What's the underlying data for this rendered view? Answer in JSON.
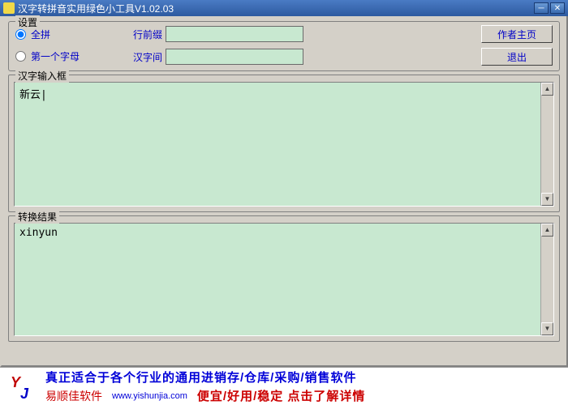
{
  "titlebar": {
    "title": "汉字转拼音实用绿色小工具V1.02.03"
  },
  "settings": {
    "legend": "设置",
    "radio_full": "全拼",
    "radio_first": "第一个字母",
    "prefix_label": "行前缀",
    "spacing_label": "汉字间",
    "prefix_value": "",
    "spacing_value": ""
  },
  "buttons": {
    "homepage": "作者主页",
    "exit": "退出"
  },
  "input_group": {
    "legend": "汉字输入框",
    "value": "新云|"
  },
  "result_group": {
    "legend": "转换结果",
    "value": "xinyun"
  },
  "footer": {
    "line1": "真正适合于各个行业的通用进销存/仓库/采购/销售软件",
    "brand": "易顺佳软件",
    "url": "www.yishunjia.com",
    "slogan": "便宜/好用/稳定 点击了解详情"
  }
}
